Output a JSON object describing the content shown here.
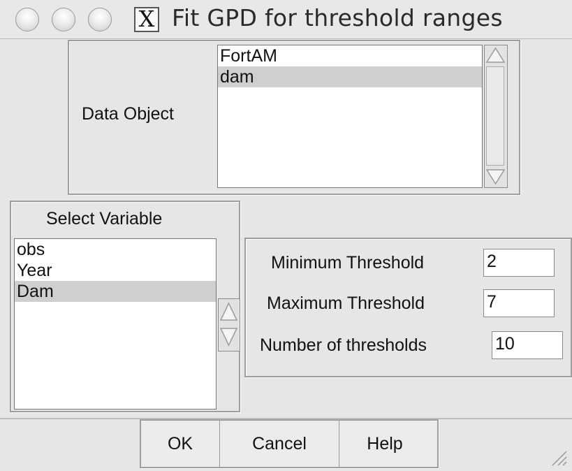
{
  "window": {
    "title": "Fit GPD for threshold ranges",
    "title_icon": "X"
  },
  "data_object": {
    "label": "Data Object",
    "items": [
      "FortAM",
      "dam"
    ],
    "selected": "dam"
  },
  "select_variable": {
    "label": "Select Variable",
    "items": [
      "obs",
      "Year",
      "Dam"
    ],
    "selected": "Dam"
  },
  "thresholds": {
    "min_label": "Minimum Threshold",
    "min_value": "2",
    "max_label": "Maximum Threshold",
    "max_value": "7",
    "count_label": "Number of thresholds",
    "count_value": "10"
  },
  "buttons": {
    "ok": "OK",
    "cancel": "Cancel",
    "help": "Help"
  },
  "colors": {
    "background": "#e6e6e6",
    "selection": "#cfcfcf"
  }
}
